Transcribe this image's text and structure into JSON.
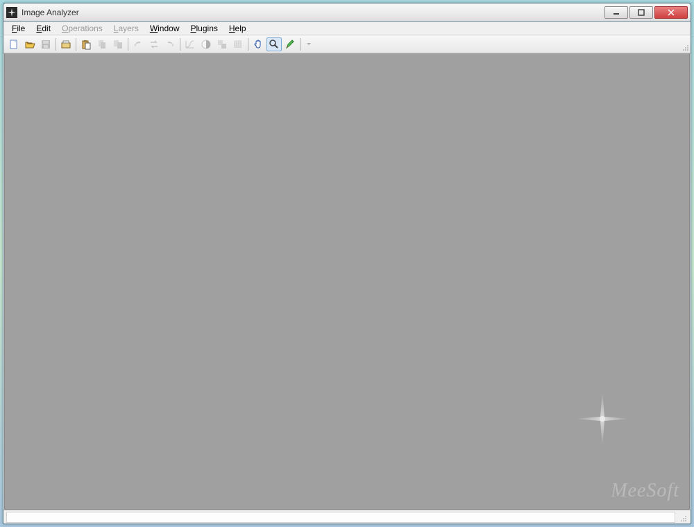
{
  "window": {
    "title": "Image Analyzer"
  },
  "menu": {
    "items": [
      {
        "label": "File",
        "accel": "F",
        "enabled": true
      },
      {
        "label": "Edit",
        "accel": "E",
        "enabled": true
      },
      {
        "label": "Operations",
        "accel": "O",
        "enabled": false
      },
      {
        "label": "Layers",
        "accel": "L",
        "enabled": false
      },
      {
        "label": "Window",
        "accel": "W",
        "enabled": true
      },
      {
        "label": "Plugins",
        "accel": "P",
        "enabled": true
      },
      {
        "label": "Help",
        "accel": "H",
        "enabled": true
      }
    ]
  },
  "toolbar": {
    "groups": [
      [
        {
          "name": "new-icon",
          "enabled": true
        },
        {
          "name": "open-icon",
          "enabled": true
        },
        {
          "name": "save-icon",
          "enabled": false
        }
      ],
      [
        {
          "name": "scanner-icon",
          "enabled": true
        }
      ],
      [
        {
          "name": "paste-icon",
          "enabled": true
        },
        {
          "name": "copy-icon",
          "enabled": false
        },
        {
          "name": "copy-all-icon",
          "enabled": false
        }
      ],
      [
        {
          "name": "undo-icon",
          "enabled": false
        },
        {
          "name": "swap-icon",
          "enabled": false
        },
        {
          "name": "redo-icon",
          "enabled": false
        }
      ],
      [
        {
          "name": "curves-icon",
          "enabled": false
        },
        {
          "name": "contrast-icon",
          "enabled": false
        },
        {
          "name": "resize-icon",
          "enabled": false
        },
        {
          "name": "grid-icon",
          "enabled": false
        }
      ],
      [
        {
          "name": "hand-icon",
          "enabled": true
        },
        {
          "name": "zoom-icon",
          "enabled": true,
          "active": true
        },
        {
          "name": "draw-icon",
          "enabled": true
        }
      ],
      [
        {
          "name": "dropdown-icon",
          "enabled": false
        }
      ]
    ]
  },
  "branding": {
    "watermark": "MeeSoft"
  }
}
